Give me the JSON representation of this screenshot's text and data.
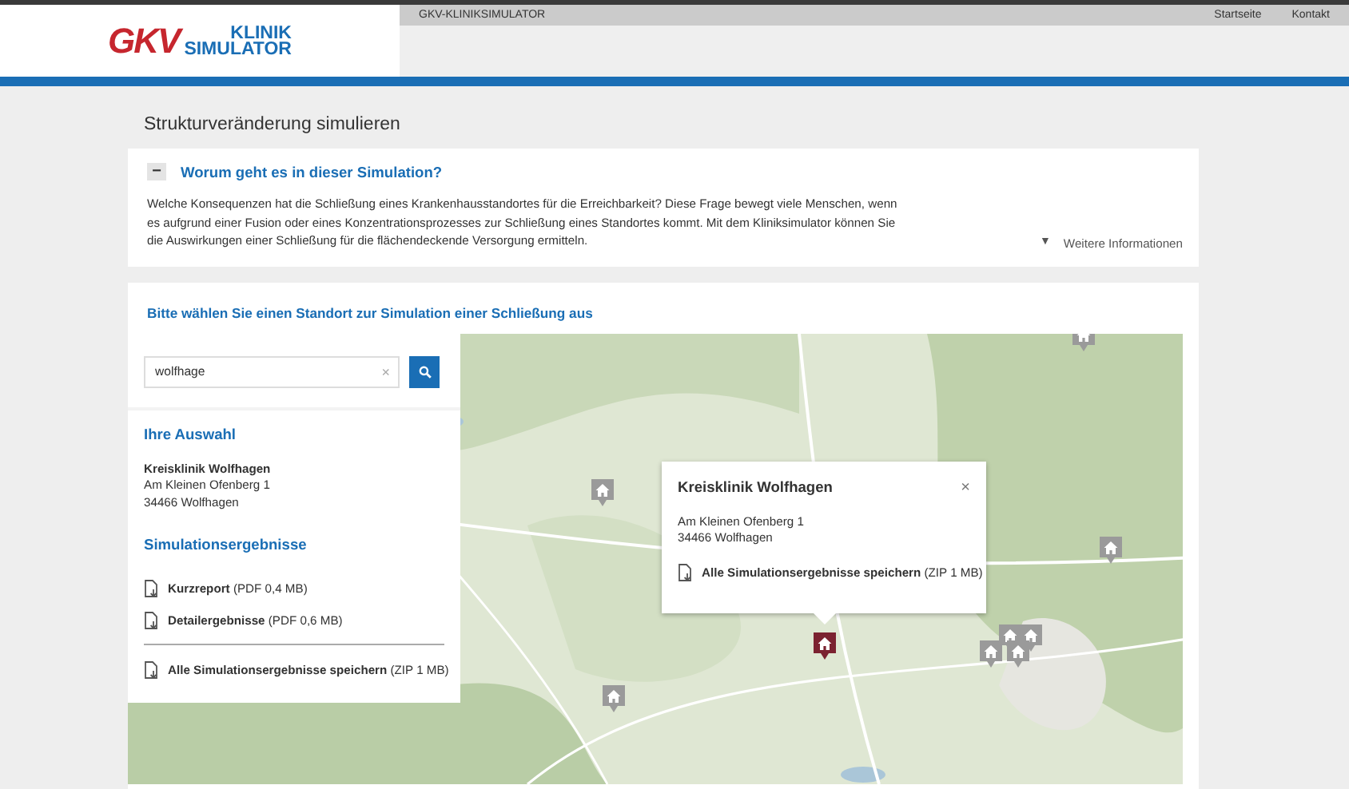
{
  "header": {
    "logo": {
      "mark": "GKV",
      "lines": [
        "KLINIK",
        "SIMULATOR"
      ]
    },
    "site_title": "GKV-KLINIKSIMULATOR",
    "nav": [
      "Startseite",
      "Kontakt"
    ]
  },
  "page_title": "Strukturveränderung simulieren",
  "intro": {
    "expanded": true,
    "toggle": "−",
    "title": "Worum geht es in dieser Simulation?",
    "text": "Welche Konsequenzen hat die Schließung eines Krankenhausstandortes für die Erreichbarkeit? Diese Frage bewegt viele Menschen, wenn es aufgrund einer Fusion oder eines Konzentrationsprozesses zur Schließung eines Standortes kommt. Mit dem Kliniksimulator können Sie die Auswirkungen einer Schließung für die flächendeckende Versorgung ermitteln.",
    "more": {
      "arrow": "▼",
      "label": "Weitere Informationen"
    }
  },
  "selection": {
    "title": "Bitte wählen Sie einen Standort zur Simulation einer Schließung aus",
    "search": {
      "value": "wolfhage",
      "clear": "×"
    },
    "choice_title": "Ihre Auswahl",
    "clinic": {
      "name": "Kreisklinik Wolfhagen",
      "address": [
        "Am Kleinen Ofenberg 1",
        "34466 Wolfhagen"
      ]
    },
    "results_title": "Simulationsergebnisse",
    "downloads": [
      {
        "label": "Kurzreport",
        "info": "(PDF 0,4 MB)"
      },
      {
        "label": "Detailergebnisse",
        "info": "(PDF 0,6 MB)"
      }
    ],
    "download_all": {
      "label": "Alle Simulationsergebnisse speichern",
      "info": "(ZIP 1 MB)"
    },
    "popup": {
      "title": "Kreisklinik Wolfhagen",
      "close": "×",
      "address": [
        "Am Kleinen Ofenberg 1",
        "34466 Wolfhagen"
      ],
      "download": {
        "label": "Alle Simulationsergebnisse speichern",
        "info": "(ZIP 1 MB)"
      }
    },
    "markers": [
      {
        "selected": true
      },
      {
        "selected": false
      },
      {
        "selected": false
      },
      {
        "selected": false
      },
      {
        "selected": false
      },
      {
        "selected": false
      },
      {
        "selected": false
      },
      {
        "selected": false
      },
      {
        "selected": false
      }
    ]
  }
}
